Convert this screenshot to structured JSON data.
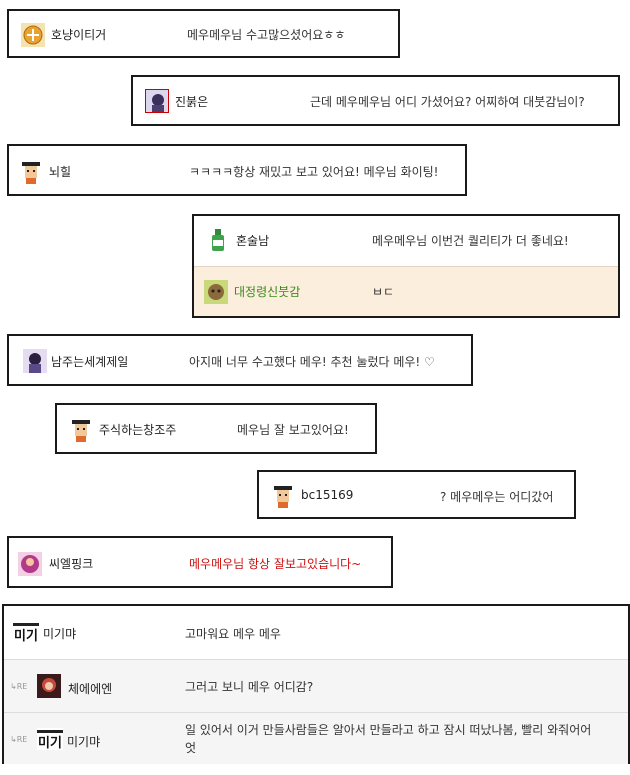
{
  "comments": [
    {
      "nick": "호냥이티거",
      "msg": "메우메우님 수고많으셨어요ㅎㅎ",
      "avatar": "tiger-badge-icon"
    },
    {
      "nick": "진붉은",
      "msg": "근데 메우메우님 어디 가셨어요? 어찌하여 대붓감님이?",
      "avatar": "anime-girl-avatar"
    },
    {
      "nick": "뇌힐",
      "msg": "ㅋㅋㅋㅋ항상 재밌고 보고 있어요! 메우님 화이팅!",
      "avatar": "graduate-pixel-avatar"
    },
    {
      "nick": "혼술남",
      "msg": "메우메우님 이번건 퀄리티가 더 좋네요!",
      "avatar": "soju-bottle-avatar"
    },
    {
      "nick": "대정령신붓감",
      "msg": "ㅂㄷ",
      "avatar": "face-avatar"
    },
    {
      "nick": "남주는세계제일",
      "msg": "아지매 너무 수고했다 메우! 추천 눌렀다 메우! ♡",
      "avatar": "anime-girl-avatar"
    },
    {
      "nick": "주식하는창조주",
      "msg": "메우님 잘 보고있어요!",
      "avatar": "graduate-pixel-avatar"
    },
    {
      "nick": "bc15169",
      "msg": "? 메우메우는 어디갔어",
      "avatar": "graduate-pixel-avatar"
    },
    {
      "nick": "씨엘핑크",
      "msg": "메우메우님 항상 잘보고있습니다~",
      "avatar": "pink-avatar"
    }
  ],
  "thread": [
    {
      "nick": "미기먀",
      "msg": "고마워요 메우 메우",
      "logo": "미기"
    },
    {
      "re": "RE",
      "nick": "체에에엔",
      "msg": "그러고 보니 메우 어디감?"
    },
    {
      "re": "RE",
      "nick": "미기먀",
      "msg": "일 있어서 이거 만들사람들은 알아서 만들라고 하고 잠시 떠났나봄, 빨리 와줘어어",
      "msg2": "엇",
      "logo": "미기"
    }
  ],
  "colors": {
    "border": "#1a1a1a",
    "highlight": "#fbeedd",
    "green": "#3a8a1a",
    "red": "#cc1111"
  }
}
